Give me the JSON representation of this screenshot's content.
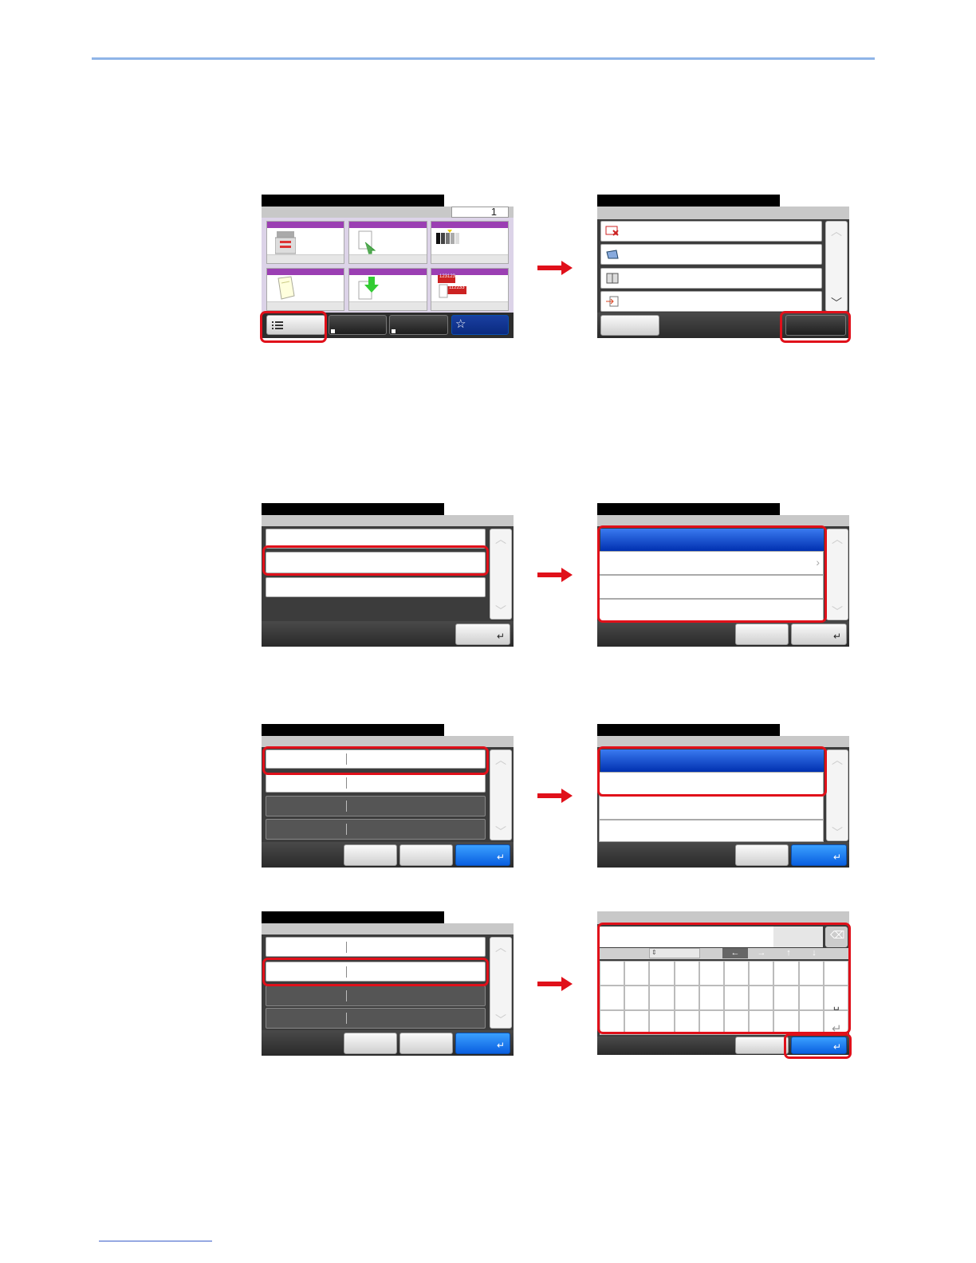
{
  "page": {
    "header_rule_color": "#8fb5e8",
    "footer_link_color": "#3b5ec9"
  },
  "colors": {
    "highlight_red": "#e0101a",
    "selected_blue": "#0a5fe0",
    "tile_purple": "#9b3fb3"
  },
  "screens": {
    "home": {
      "counter": "1",
      "icons": [
        "copier-icon",
        "document-send-icon",
        "color-bars-icon",
        "paper-icon",
        "download-icon",
        "page-stack-icon"
      ],
      "tile_labels": [
        "123123",
        "112233"
      ],
      "footer_icons": [
        "list-icon",
        "shortcut-icon",
        "shortcut-icon",
        "star-icon"
      ]
    },
    "menu_list": {
      "icons": [
        "printer-error-icon",
        "scan-icon",
        "book-icon",
        "import-icon"
      ]
    },
    "keyboard": {
      "nav_icons": [
        "up-down-icon",
        "left-arrow-icon",
        "right-arrow-icon",
        "up-arrow-icon",
        "down-arrow-icon"
      ],
      "special_icons": [
        "backspace-icon",
        "space-icon",
        "enter-icon"
      ]
    }
  }
}
